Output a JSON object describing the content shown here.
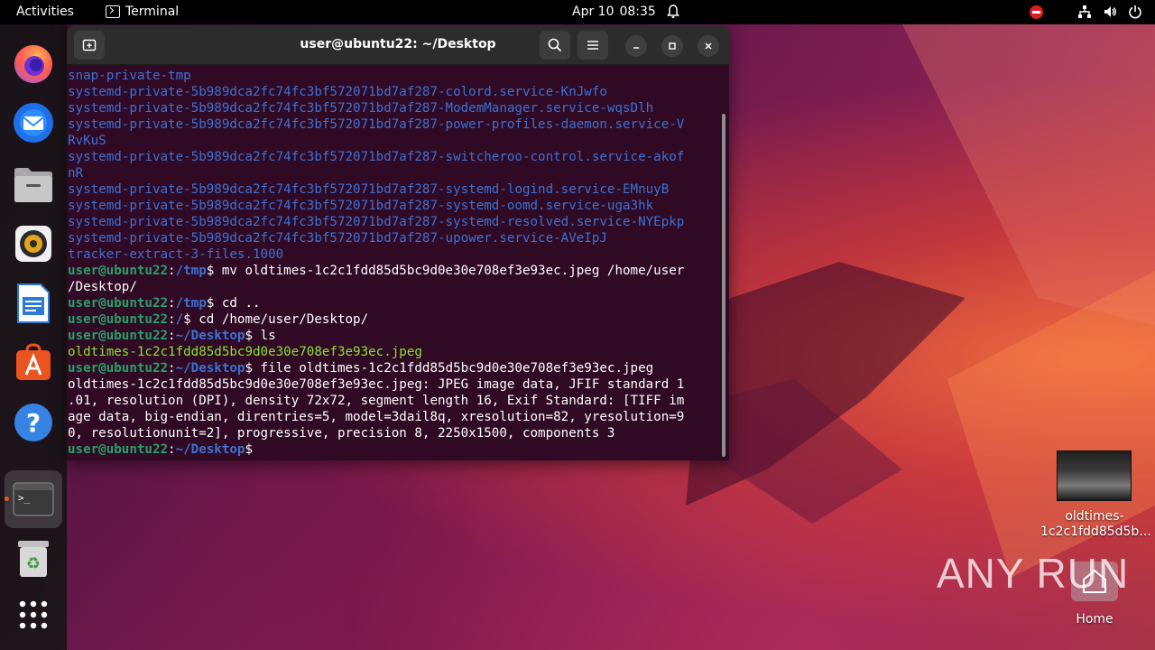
{
  "topbar": {
    "activities": "Activities",
    "app_name": "Terminal",
    "date": "Apr 10",
    "time": "08:35"
  },
  "dock": {
    "items": [
      "firefox",
      "thunderbird",
      "files",
      "rhythmbox",
      "libreoffice-writer",
      "app-center",
      "help",
      "terminal",
      "trash",
      "show-apps"
    ]
  },
  "window": {
    "title": "user@ubuntu22: ~/Desktop"
  },
  "terminal": {
    "lines": [
      [
        {
          "t": "snap-private-tmp",
          "c": "c-blue"
        }
      ],
      [
        {
          "t": "systemd-private-5b989dca2fc74fc3bf572071bd7af287-colord.service-KnJwfo",
          "c": "c-blue"
        }
      ],
      [
        {
          "t": "systemd-private-5b989dca2fc74fc3bf572071bd7af287-ModemManager.service-wqsDlh",
          "c": "c-blue"
        }
      ],
      [
        {
          "t": "systemd-private-5b989dca2fc74fc3bf572071bd7af287-power-profiles-daemon.service-V",
          "c": "c-blue"
        }
      ],
      [
        {
          "t": "RvKuS",
          "c": "c-blue"
        }
      ],
      [
        {
          "t": "systemd-private-5b989dca2fc74fc3bf572071bd7af287-switcheroo-control.service-akof",
          "c": "c-blue"
        }
      ],
      [
        {
          "t": "nR",
          "c": "c-blue"
        }
      ],
      [
        {
          "t": "systemd-private-5b989dca2fc74fc3bf572071bd7af287-systemd-logind.service-EMnuyB",
          "c": "c-blue"
        }
      ],
      [
        {
          "t": "systemd-private-5b989dca2fc74fc3bf572071bd7af287-systemd-oomd.service-uga3hk",
          "c": "c-blue"
        }
      ],
      [
        {
          "t": "systemd-private-5b989dca2fc74fc3bf572071bd7af287-systemd-resolved.service-NYEpkp",
          "c": "c-blue"
        }
      ],
      [
        {
          "t": "systemd-private-5b989dca2fc74fc3bf572071bd7af287-upower.service-AVeIpJ",
          "c": "c-blue"
        }
      ],
      [
        {
          "t": "tracker-extract-3-files.1000",
          "c": "c-blue"
        }
      ],
      [
        {
          "t": "user@ubuntu22",
          "c": "c-green"
        },
        {
          "t": ":",
          "c": "c-plain"
        },
        {
          "t": "/tmp",
          "c": "c-path"
        },
        {
          "t": "$ mv oldtimes-1c2c1fdd85d5bc9d0e30e708ef3e93ec.jpeg /home/user",
          "c": "c-plain"
        }
      ],
      [
        {
          "t": "/Desktop/",
          "c": "c-plain"
        }
      ],
      [
        {
          "t": "user@ubuntu22",
          "c": "c-green"
        },
        {
          "t": ":",
          "c": "c-plain"
        },
        {
          "t": "/tmp",
          "c": "c-path"
        },
        {
          "t": "$ cd ..",
          "c": "c-plain"
        }
      ],
      [
        {
          "t": "user@ubuntu22",
          "c": "c-green"
        },
        {
          "t": ":",
          "c": "c-plain"
        },
        {
          "t": "/",
          "c": "c-path"
        },
        {
          "t": "$ cd /home/user/Desktop/",
          "c": "c-plain"
        }
      ],
      [
        {
          "t": "user@ubuntu22",
          "c": "c-green"
        },
        {
          "t": ":",
          "c": "c-plain"
        },
        {
          "t": "~/Desktop",
          "c": "c-path"
        },
        {
          "t": "$ ls",
          "c": "c-plain"
        }
      ],
      [
        {
          "t": "oldtimes-1c2c1fdd85d5bc9d0e30e708ef3e93ec.jpeg",
          "c": "c-file"
        }
      ],
      [
        {
          "t": "user@ubuntu22",
          "c": "c-green"
        },
        {
          "t": ":",
          "c": "c-plain"
        },
        {
          "t": "~/Desktop",
          "c": "c-path"
        },
        {
          "t": "$ file oldtimes-1c2c1fdd85d5bc9d0e30e708ef3e93ec.jpeg",
          "c": "c-plain"
        }
      ],
      [
        {
          "t": "oldtimes-1c2c1fdd85d5bc9d0e30e708ef3e93ec.jpeg: JPEG image data, JFIF standard 1",
          "c": "c-plain"
        }
      ],
      [
        {
          "t": ".01, resolution (DPI), density 72x72, segment length 16, Exif Standard: [TIFF im",
          "c": "c-plain"
        }
      ],
      [
        {
          "t": "age data, big-endian, direntries=5, model=3dail8q, xresolution=82, yresolution=9",
          "c": "c-plain"
        }
      ],
      [
        {
          "t": "0, resolutionunit=2], progressive, precision 8, 2250x1500, components 3",
          "c": "c-plain"
        }
      ],
      [
        {
          "t": "user@ubuntu22",
          "c": "c-green"
        },
        {
          "t": ":",
          "c": "c-plain"
        },
        {
          "t": "~/Desktop",
          "c": "c-path"
        },
        {
          "t": "$",
          "c": "c-plain"
        }
      ]
    ]
  },
  "desktop": {
    "file_icon_label_line1": "oldtimes-",
    "file_icon_label_line2": "1c2c1fdd85d5b...",
    "home_label": "Home",
    "watermark": "ANY RUN"
  },
  "colors": {
    "terminal_bg": "#300a24",
    "prompt_green": "#26a269",
    "path_blue": "#3d72d4",
    "accent_orange": "#e95420"
  }
}
